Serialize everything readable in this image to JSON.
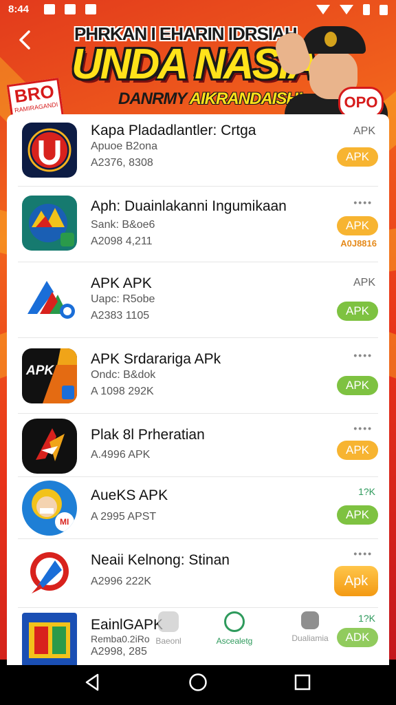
{
  "status": {
    "time": "8:44"
  },
  "banner": {
    "line1": "PHRKAN I EHARIN IDRSIAH",
    "line2": "UNDA NASIAI",
    "line3_pre": "DANRMY ",
    "line3_hl": "AIKRANDAISH!",
    "badge_main": "BRO",
    "badge_sub": "RAMIRAGANDI",
    "oppo_label": "OPO"
  },
  "apps": [
    {
      "title": "Kapa Pladadlantler: Crtga",
      "meta1": "Apuoe B2ona",
      "meta2": "A2376, 8308",
      "top_label": "APK",
      "button": "APK",
      "button_color": "orange"
    },
    {
      "title": "Aph: Duainlakanni Ingumikaan",
      "meta1": "Sank: B&oe6",
      "meta2": "A2098 4,211",
      "top_label": "••••",
      "button": "APK",
      "button_color": "orange",
      "subnote": "A0J8816"
    },
    {
      "title": "APK APK",
      "meta1": "Uapc: R5obe",
      "meta2": "A2383 1105",
      "top_label": "APK",
      "button": "APK",
      "button_color": "green"
    },
    {
      "title": "APK Srdarariga APk",
      "meta1": "Ondc: B&dok",
      "meta2": "A 1098 292K",
      "top_label": "••••",
      "button": "APK",
      "button_color": "green"
    },
    {
      "title": "Plak 8l Prheratian",
      "meta1": "",
      "meta2": "A.4996 APK",
      "top_label": "••••",
      "button": "APK",
      "button_color": "orange"
    },
    {
      "title": "AueKS APK",
      "meta1": "",
      "meta2": "A 2995 APST",
      "top_label": "1?K",
      "button": "APK",
      "button_color": "green"
    },
    {
      "title": "Neaii Kelnong: Stinan",
      "meta1": "",
      "meta2": "A2996 222K",
      "top_label": "••••",
      "button": "Apk",
      "button_color": "big"
    },
    {
      "title": "EainlGAPK",
      "meta1": "Remba0.2iRo",
      "meta2": "A2998, 285",
      "top_label": "1?K",
      "button": "ADK",
      "button_color": "green"
    }
  ],
  "icon_texts": {
    "apk4": "APK",
    "app6": "MI"
  },
  "tabs": [
    {
      "label": "Baeonl",
      "color": "#999999"
    },
    {
      "label": "Ascealetg",
      "color": "#2e9a5c"
    },
    {
      "label": "Dualiamia",
      "color": "#999999"
    }
  ]
}
